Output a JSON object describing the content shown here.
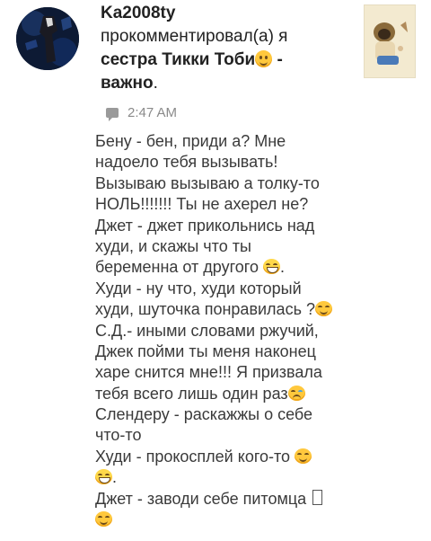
{
  "header": {
    "username": "Ka2008ty",
    "action_prefix": "прокомментировал(а) я",
    "post_title_line2": "сестра Тикки Тоби",
    "post_title_suffix": " -",
    "post_title_line3": "важно",
    "post_title_end": "."
  },
  "meta": {
    "time": "2:47 AM"
  },
  "comment": {
    "lines": [
      {
        "text": "Бену - бен, приди а?  Мне",
        "emoji": null
      },
      {
        "text": "надоело тебя вызывать!",
        "emoji": null
      },
      {
        "text": "Вызываю вызываю а толку-то",
        "emoji": null
      },
      {
        "text": "НОЛЬ!!!!!!! Ты не ахерел не?",
        "emoji": null
      },
      {
        "text": "Джет - джет прикольнись над",
        "emoji": null
      },
      {
        "text": "худи, и скажы что ты",
        "emoji": null
      },
      {
        "text": "беременна от другого ",
        "emoji": "grin",
        "after": "."
      },
      {
        "text": "Худи - ну что, худи который",
        "emoji": null
      },
      {
        "text": "худи, шуточка понравилась ?",
        "emoji": "smile"
      },
      {
        "text": "С.Д.- иными словами ржучий,",
        "emoji": null
      },
      {
        "text": "Джек пойми ты меня наконец",
        "emoji": null
      },
      {
        "text": "харе снится мне!!! Я призвала",
        "emoji": null
      },
      {
        "text": "тебя всего лишь один раз",
        "emoji": "cry"
      },
      {
        "text": "Слендеру - раскажжы о себе",
        "emoji": null
      },
      {
        "text": "что-то",
        "emoji": null
      },
      {
        "text": "Худи - прокосплей кого-то ",
        "emoji": "smile"
      },
      {
        "text": "",
        "emoji": "grin",
        "after": "."
      },
      {
        "text": "Джет - заводи себе питомца ",
        "emoji": "box"
      },
      {
        "text": "",
        "emoji": "smile"
      }
    ]
  },
  "icons": {
    "comment": "comment-icon",
    "avatar": "user-avatar",
    "thumbnail": "post-thumbnail"
  },
  "colors": {
    "emoji_yellow": "#ffc83d",
    "meta_gray": "#8a8a8a",
    "text": "#3a3a3a"
  }
}
